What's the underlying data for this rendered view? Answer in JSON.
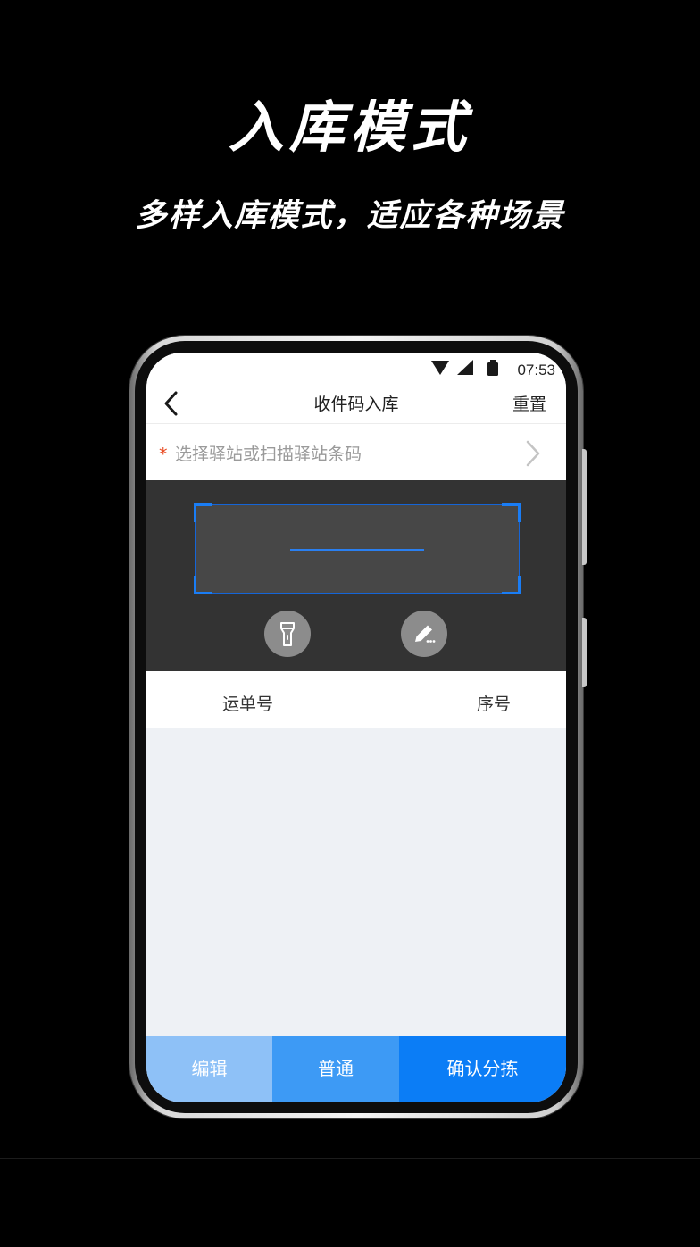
{
  "promo": {
    "title": "入库模式",
    "subtitle": "多样入库模式，适应各种场景"
  },
  "statusbar": {
    "time": "07:53",
    "icons": [
      "wifi-icon",
      "cellular-signal-icon",
      "battery-icon"
    ]
  },
  "navbar": {
    "back_icon": "chevron-left-icon",
    "title": "收件码入库",
    "reset_label": "重置"
  },
  "station": {
    "required_mark": "*",
    "placeholder": "选择驿站或扫描驿站条码",
    "chevron_icon": "chevron-right-icon"
  },
  "scanner": {
    "flashlight_icon": "flashlight-icon",
    "manual_input_icon": "pencil-icon"
  },
  "table": {
    "columns": [
      "运单号",
      "序号"
    ],
    "rows": []
  },
  "bottom_bar": {
    "edit_label": "编辑",
    "normal_label": "普通",
    "confirm_label": "确认分拣"
  },
  "colors": {
    "accent": "#0b7df6",
    "scan_frame": "#1a7df5",
    "required": "#e8471e"
  }
}
